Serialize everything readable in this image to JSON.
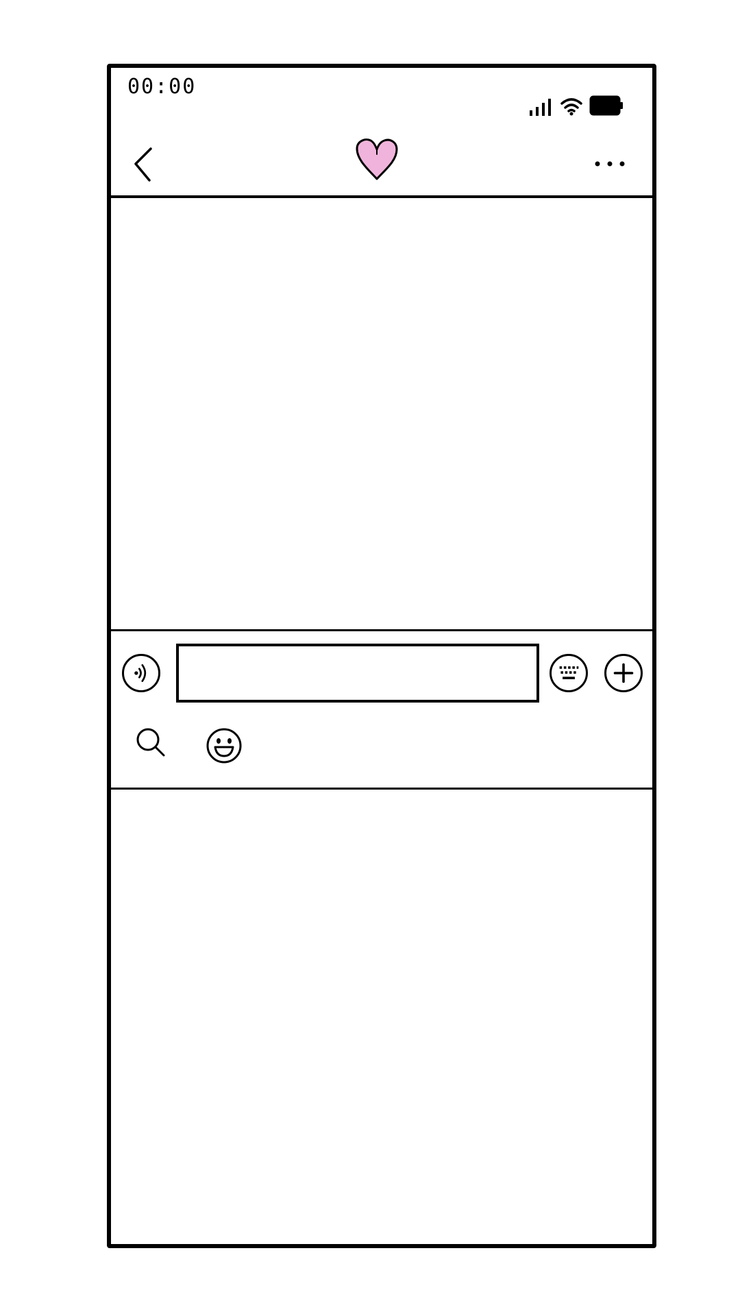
{
  "status_bar": {
    "time": "00:00",
    "icons": [
      "signal-icon",
      "wifi-icon",
      "battery-icon"
    ]
  },
  "nav_bar": {
    "back_icon": "chevron-left-icon",
    "title_icon": "heart-icon",
    "more_icon": "ellipsis-icon"
  },
  "input_bar": {
    "voice_icon": "voice-icon",
    "text_value": "",
    "placeholder": "",
    "keyboard_icon": "keyboard-icon",
    "add_icon": "plus-icon",
    "search_icon": "search-icon",
    "emoji_icon": "emoji-icon"
  },
  "colors": {
    "stroke": "#000000",
    "heart_fill": "#F0B4DC",
    "background": "#FFFFFF"
  }
}
